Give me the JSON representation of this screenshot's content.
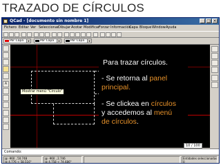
{
  "slide": {
    "title": "TRAZADO DE CÍRCULOS"
  },
  "window": {
    "title": "QCad - [documento sin nombre 1]",
    "controls": [
      "_",
      "□",
      "×"
    ]
  },
  "menu": [
    "Fichero",
    "Editar",
    "Ver",
    "Seleccionar",
    "Dibujar",
    "Acotar",
    "Modificar",
    "Forzar",
    "Información",
    "Capa",
    "Bloque",
    "Window",
    "Ayuda"
  ],
  "toolbar2": {
    "color_combo": "Por Capa",
    "width_combo": "Por Capa",
    "style_combo": "Por Capa"
  },
  "canvas": {
    "tooltip": "Mostrar menú \"Círculo\"",
    "page_indicator": "10 / 100"
  },
  "command": {
    "label": "Comando:"
  },
  "status": {
    "abs_coords": "@ -960 , 50.748",
    "abs_polar": "@ 4.776 < 58.516°",
    "rel_coords": "@ -960 , 2.746",
    "rel_polar": "@ 4.758 < 74.686°",
    "selected_label": "Entidades seleccionadas:",
    "selected_count": "0"
  },
  "overlay": {
    "line1": "Para trazar círculos.",
    "line2_pre": "- Se retorna al ",
    "line2_hl": "panel",
    "line3_hl": "principal.",
    "line4_pre": "- Se clickea en ",
    "line4_hl": "círculos",
    "line5_pre": "y accedemos al ",
    "line5_hl": "menú",
    "line6_hl": "de círculos",
    "line6_post": "."
  },
  "colors": {
    "highlight": "#e8922a",
    "titlebar": "#0a246a",
    "canvas": "#000000"
  }
}
